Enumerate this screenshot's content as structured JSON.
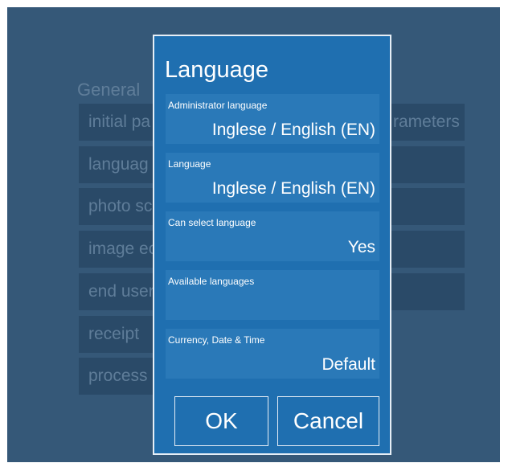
{
  "background": {
    "section_title": "General",
    "left_buttons": [
      "initial pa",
      "languag",
      "photo sc",
      "image ec",
      "end user",
      "receipt",
      "process"
    ],
    "right_buttons": [
      "rameters",
      "",
      "",
      "",
      ""
    ]
  },
  "dialog": {
    "title": "Language",
    "rows": [
      {
        "label": "Administrator language",
        "value": "Inglese / English (EN)"
      },
      {
        "label": "Language",
        "value": "Inglese / English (EN)"
      },
      {
        "label": "Can select language",
        "value": "Yes"
      },
      {
        "label": "Available languages",
        "value": ""
      },
      {
        "label": "Currency, Date & Time",
        "value": "Default"
      }
    ],
    "ok_label": "OK",
    "cancel_label": "Cancel"
  },
  "colors": {
    "screen_background": "#355878",
    "background_button": "#2a4a68",
    "dialog_background": "#1f6fb0",
    "row_background": "#2a79b8",
    "text": "#ffffff"
  }
}
